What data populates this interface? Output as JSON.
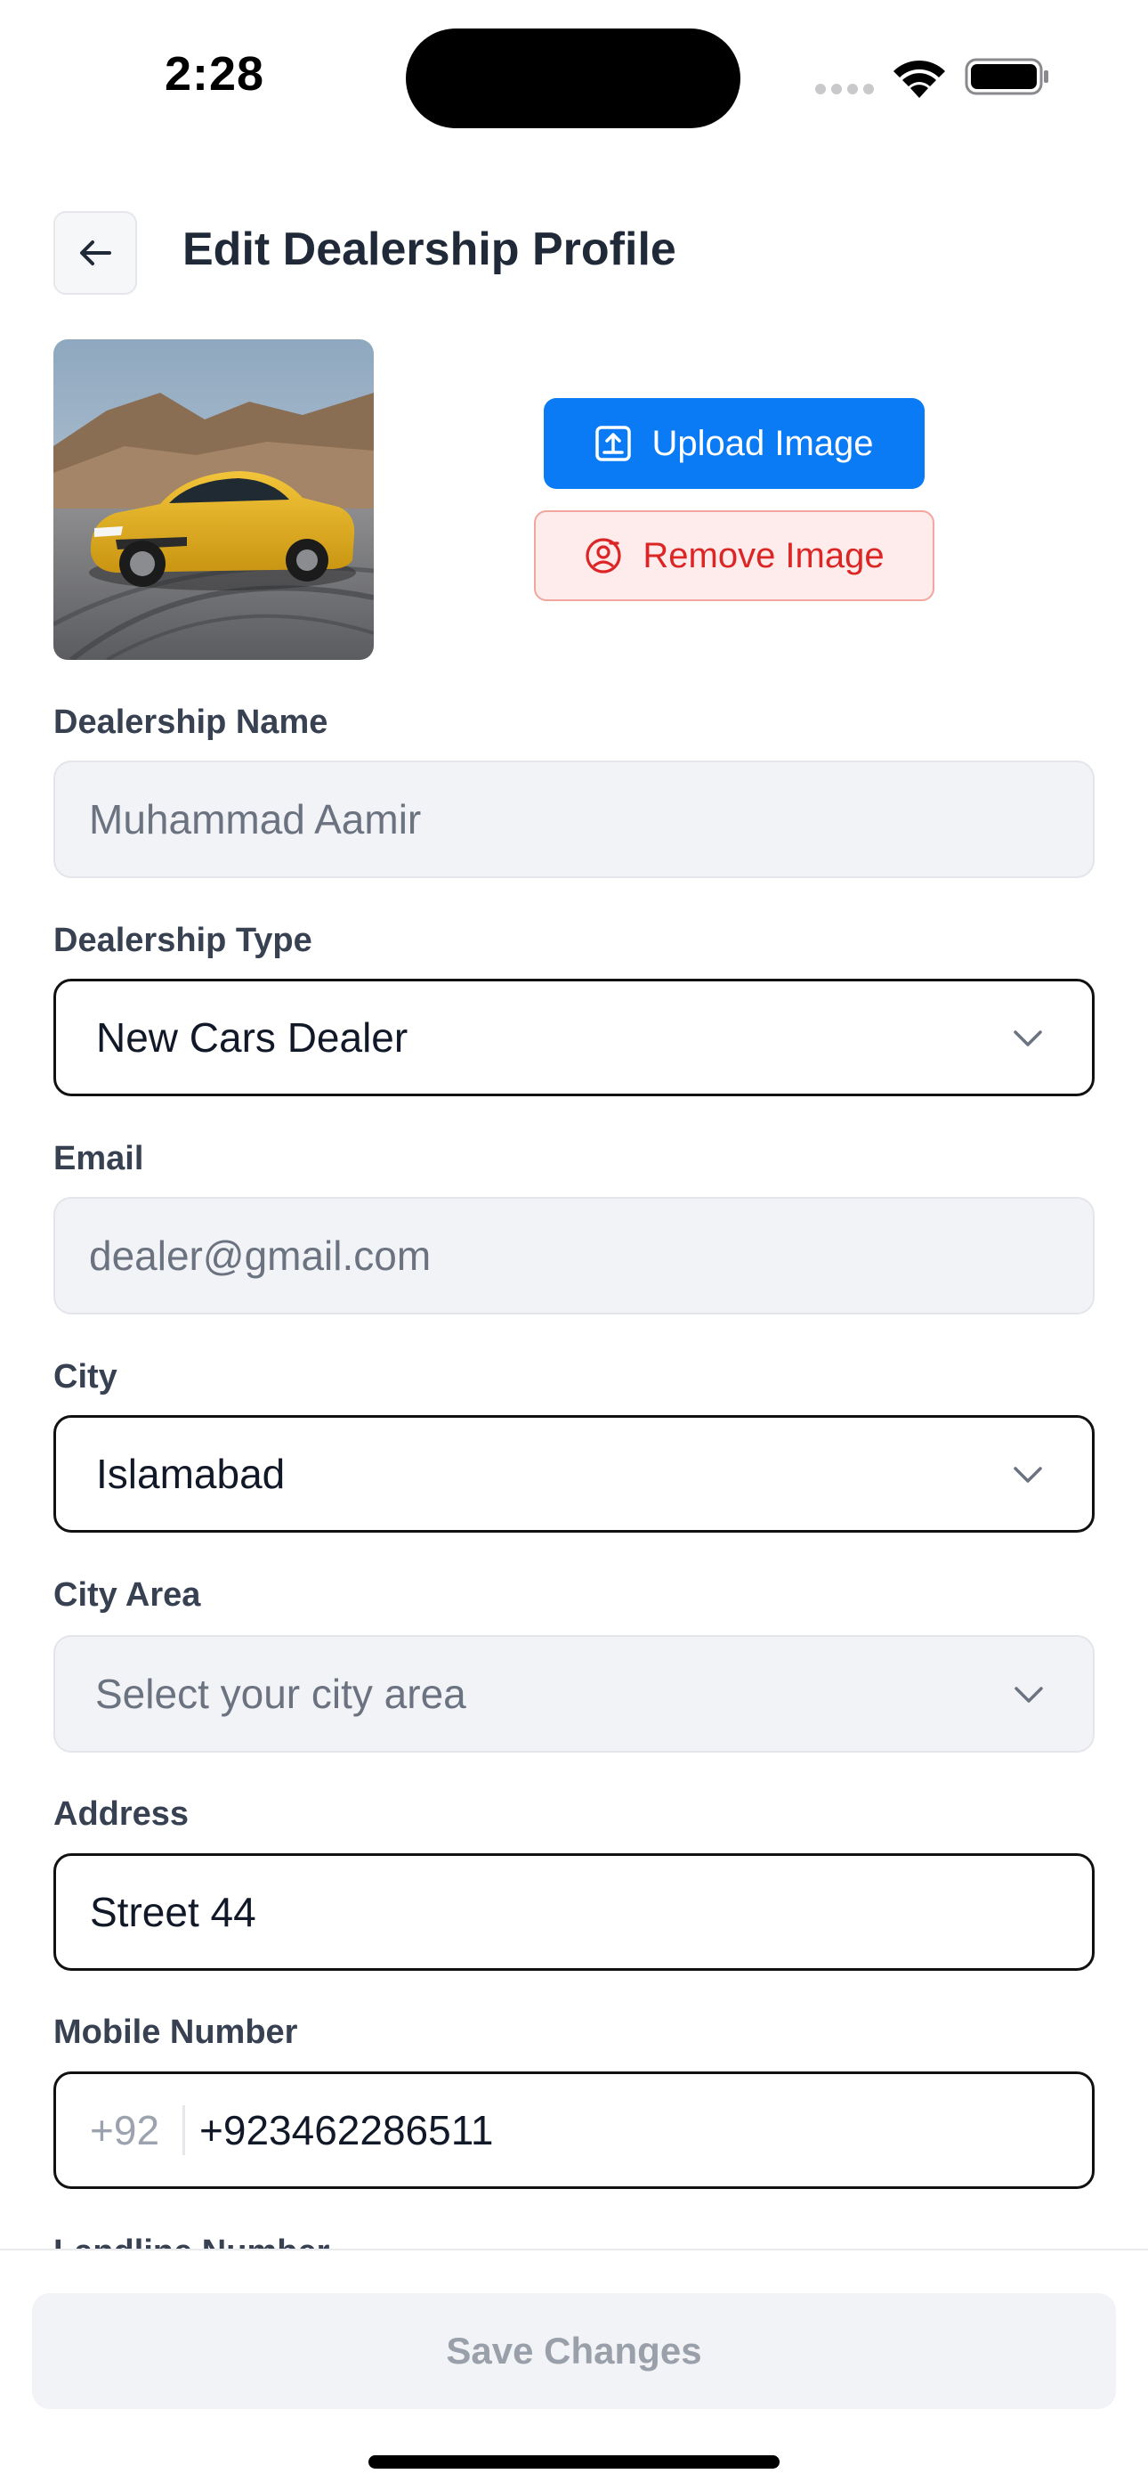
{
  "status_bar": {
    "time": "2:28"
  },
  "header": {
    "title": "Edit Dealership Profile",
    "back_icon": "arrow-left-icon"
  },
  "profile_image": {
    "alt": "yellow sports car photo",
    "upload_label": "Upload Image",
    "upload_icon": "upload-icon",
    "remove_label": "Remove Image",
    "remove_icon": "user-remove-icon"
  },
  "form": {
    "dealership_name": {
      "label": "Dealership Name",
      "value": "Muhammad Aamir",
      "disabled": true
    },
    "dealership_type": {
      "label": "Dealership Type",
      "value": "New Cars Dealer"
    },
    "email": {
      "label": "Email",
      "value": "dealer@gmail.com",
      "disabled": true
    },
    "city": {
      "label": "City",
      "value": "Islamabad"
    },
    "city_area": {
      "label": "City Area",
      "placeholder": "Select your city area",
      "disabled": true
    },
    "address": {
      "label": "Address",
      "value": "Street 44"
    },
    "mobile": {
      "label": "Mobile Number",
      "prefix": "+92",
      "value": "+923462286511"
    },
    "landline": {
      "label": "Landline Number"
    }
  },
  "footer": {
    "save_label": "Save Changes"
  },
  "colors": {
    "primary": "#0b7bf5",
    "danger": "#dc2626",
    "danger_bg": "#fdeceb",
    "disabled_bg": "#f2f3f6"
  }
}
